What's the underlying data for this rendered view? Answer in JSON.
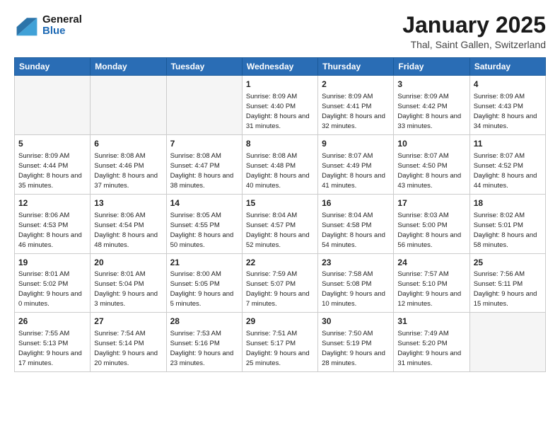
{
  "header": {
    "logo_general": "General",
    "logo_blue": "Blue",
    "month_title": "January 2025",
    "location": "Thal, Saint Gallen, Switzerland"
  },
  "days_of_week": [
    "Sunday",
    "Monday",
    "Tuesday",
    "Wednesday",
    "Thursday",
    "Friday",
    "Saturday"
  ],
  "weeks": [
    [
      {
        "day": "",
        "empty": true
      },
      {
        "day": "",
        "empty": true
      },
      {
        "day": "",
        "empty": true
      },
      {
        "day": "1",
        "sunrise": "8:09 AM",
        "sunset": "4:40 PM",
        "daylight": "8 hours and 31 minutes."
      },
      {
        "day": "2",
        "sunrise": "8:09 AM",
        "sunset": "4:41 PM",
        "daylight": "8 hours and 32 minutes."
      },
      {
        "day": "3",
        "sunrise": "8:09 AM",
        "sunset": "4:42 PM",
        "daylight": "8 hours and 33 minutes."
      },
      {
        "day": "4",
        "sunrise": "8:09 AM",
        "sunset": "4:43 PM",
        "daylight": "8 hours and 34 minutes."
      }
    ],
    [
      {
        "day": "5",
        "sunrise": "8:09 AM",
        "sunset": "4:44 PM",
        "daylight": "8 hours and 35 minutes."
      },
      {
        "day": "6",
        "sunrise": "8:08 AM",
        "sunset": "4:46 PM",
        "daylight": "8 hours and 37 minutes."
      },
      {
        "day": "7",
        "sunrise": "8:08 AM",
        "sunset": "4:47 PM",
        "daylight": "8 hours and 38 minutes."
      },
      {
        "day": "8",
        "sunrise": "8:08 AM",
        "sunset": "4:48 PM",
        "daylight": "8 hours and 40 minutes."
      },
      {
        "day": "9",
        "sunrise": "8:07 AM",
        "sunset": "4:49 PM",
        "daylight": "8 hours and 41 minutes."
      },
      {
        "day": "10",
        "sunrise": "8:07 AM",
        "sunset": "4:50 PM",
        "daylight": "8 hours and 43 minutes."
      },
      {
        "day": "11",
        "sunrise": "8:07 AM",
        "sunset": "4:52 PM",
        "daylight": "8 hours and 44 minutes."
      }
    ],
    [
      {
        "day": "12",
        "sunrise": "8:06 AM",
        "sunset": "4:53 PM",
        "daylight": "8 hours and 46 minutes."
      },
      {
        "day": "13",
        "sunrise": "8:06 AM",
        "sunset": "4:54 PM",
        "daylight": "8 hours and 48 minutes."
      },
      {
        "day": "14",
        "sunrise": "8:05 AM",
        "sunset": "4:55 PM",
        "daylight": "8 hours and 50 minutes."
      },
      {
        "day": "15",
        "sunrise": "8:04 AM",
        "sunset": "4:57 PM",
        "daylight": "8 hours and 52 minutes."
      },
      {
        "day": "16",
        "sunrise": "8:04 AM",
        "sunset": "4:58 PM",
        "daylight": "8 hours and 54 minutes."
      },
      {
        "day": "17",
        "sunrise": "8:03 AM",
        "sunset": "5:00 PM",
        "daylight": "8 hours and 56 minutes."
      },
      {
        "day": "18",
        "sunrise": "8:02 AM",
        "sunset": "5:01 PM",
        "daylight": "8 hours and 58 minutes."
      }
    ],
    [
      {
        "day": "19",
        "sunrise": "8:01 AM",
        "sunset": "5:02 PM",
        "daylight": "9 hours and 0 minutes."
      },
      {
        "day": "20",
        "sunrise": "8:01 AM",
        "sunset": "5:04 PM",
        "daylight": "9 hours and 3 minutes."
      },
      {
        "day": "21",
        "sunrise": "8:00 AM",
        "sunset": "5:05 PM",
        "daylight": "9 hours and 5 minutes."
      },
      {
        "day": "22",
        "sunrise": "7:59 AM",
        "sunset": "5:07 PM",
        "daylight": "9 hours and 7 minutes."
      },
      {
        "day": "23",
        "sunrise": "7:58 AM",
        "sunset": "5:08 PM",
        "daylight": "9 hours and 10 minutes."
      },
      {
        "day": "24",
        "sunrise": "7:57 AM",
        "sunset": "5:10 PM",
        "daylight": "9 hours and 12 minutes."
      },
      {
        "day": "25",
        "sunrise": "7:56 AM",
        "sunset": "5:11 PM",
        "daylight": "9 hours and 15 minutes."
      }
    ],
    [
      {
        "day": "26",
        "sunrise": "7:55 AM",
        "sunset": "5:13 PM",
        "daylight": "9 hours and 17 minutes."
      },
      {
        "day": "27",
        "sunrise": "7:54 AM",
        "sunset": "5:14 PM",
        "daylight": "9 hours and 20 minutes."
      },
      {
        "day": "28",
        "sunrise": "7:53 AM",
        "sunset": "5:16 PM",
        "daylight": "9 hours and 23 minutes."
      },
      {
        "day": "29",
        "sunrise": "7:51 AM",
        "sunset": "5:17 PM",
        "daylight": "9 hours and 25 minutes."
      },
      {
        "day": "30",
        "sunrise": "7:50 AM",
        "sunset": "5:19 PM",
        "daylight": "9 hours and 28 minutes."
      },
      {
        "day": "31",
        "sunrise": "7:49 AM",
        "sunset": "5:20 PM",
        "daylight": "9 hours and 31 minutes."
      },
      {
        "day": "",
        "empty": true
      }
    ]
  ],
  "labels": {
    "sunrise": "Sunrise:",
    "sunset": "Sunset:",
    "daylight": "Daylight:"
  }
}
